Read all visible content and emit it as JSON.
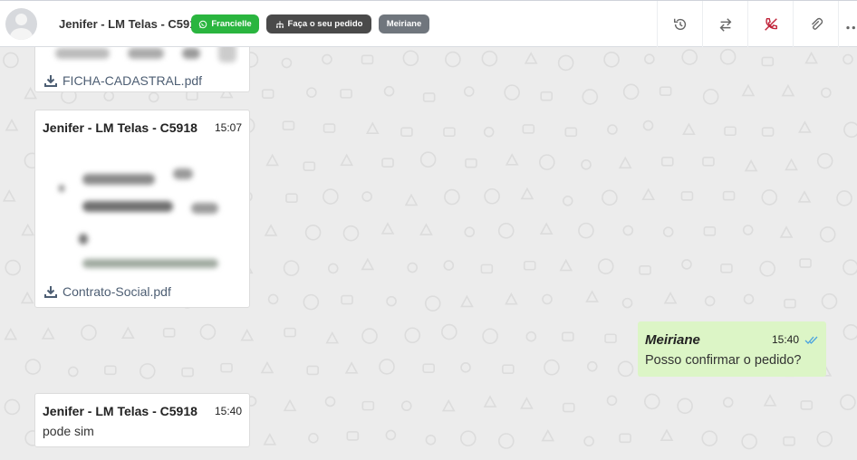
{
  "header": {
    "contact_name": "Jenifer - LM Telas - C5918",
    "tags": [
      "Francielle",
      "Faça o seu pedido",
      "Meiriane"
    ],
    "actions": [
      "history-icon",
      "transfer-icon",
      "end-call-icon",
      "attachment-icon",
      "more-icon"
    ]
  },
  "messages": {
    "file1": {
      "filename": "FICHA-CADASTRAL.pdf"
    },
    "file2": {
      "sender": "Jenifer - LM Telas - C5918",
      "time": "15:07",
      "filename": "Contrato-Social.pdf"
    },
    "outgoing": {
      "sender": "Meiriane",
      "time": "15:40",
      "text": "Posso confirmar o pedido?"
    },
    "incoming": {
      "sender": "Jenifer - LM Telas - C5918",
      "time": "15:40",
      "text": "pode sim"
    }
  },
  "colors": {
    "accent_green": "#2ab53f",
    "tag_dark": "#4a4a4a",
    "tag_gray": "#70767d",
    "end_call": "#c0243a",
    "outgoing_bubble": "#dcf5c6",
    "read_ticks": "#4aa3df"
  }
}
